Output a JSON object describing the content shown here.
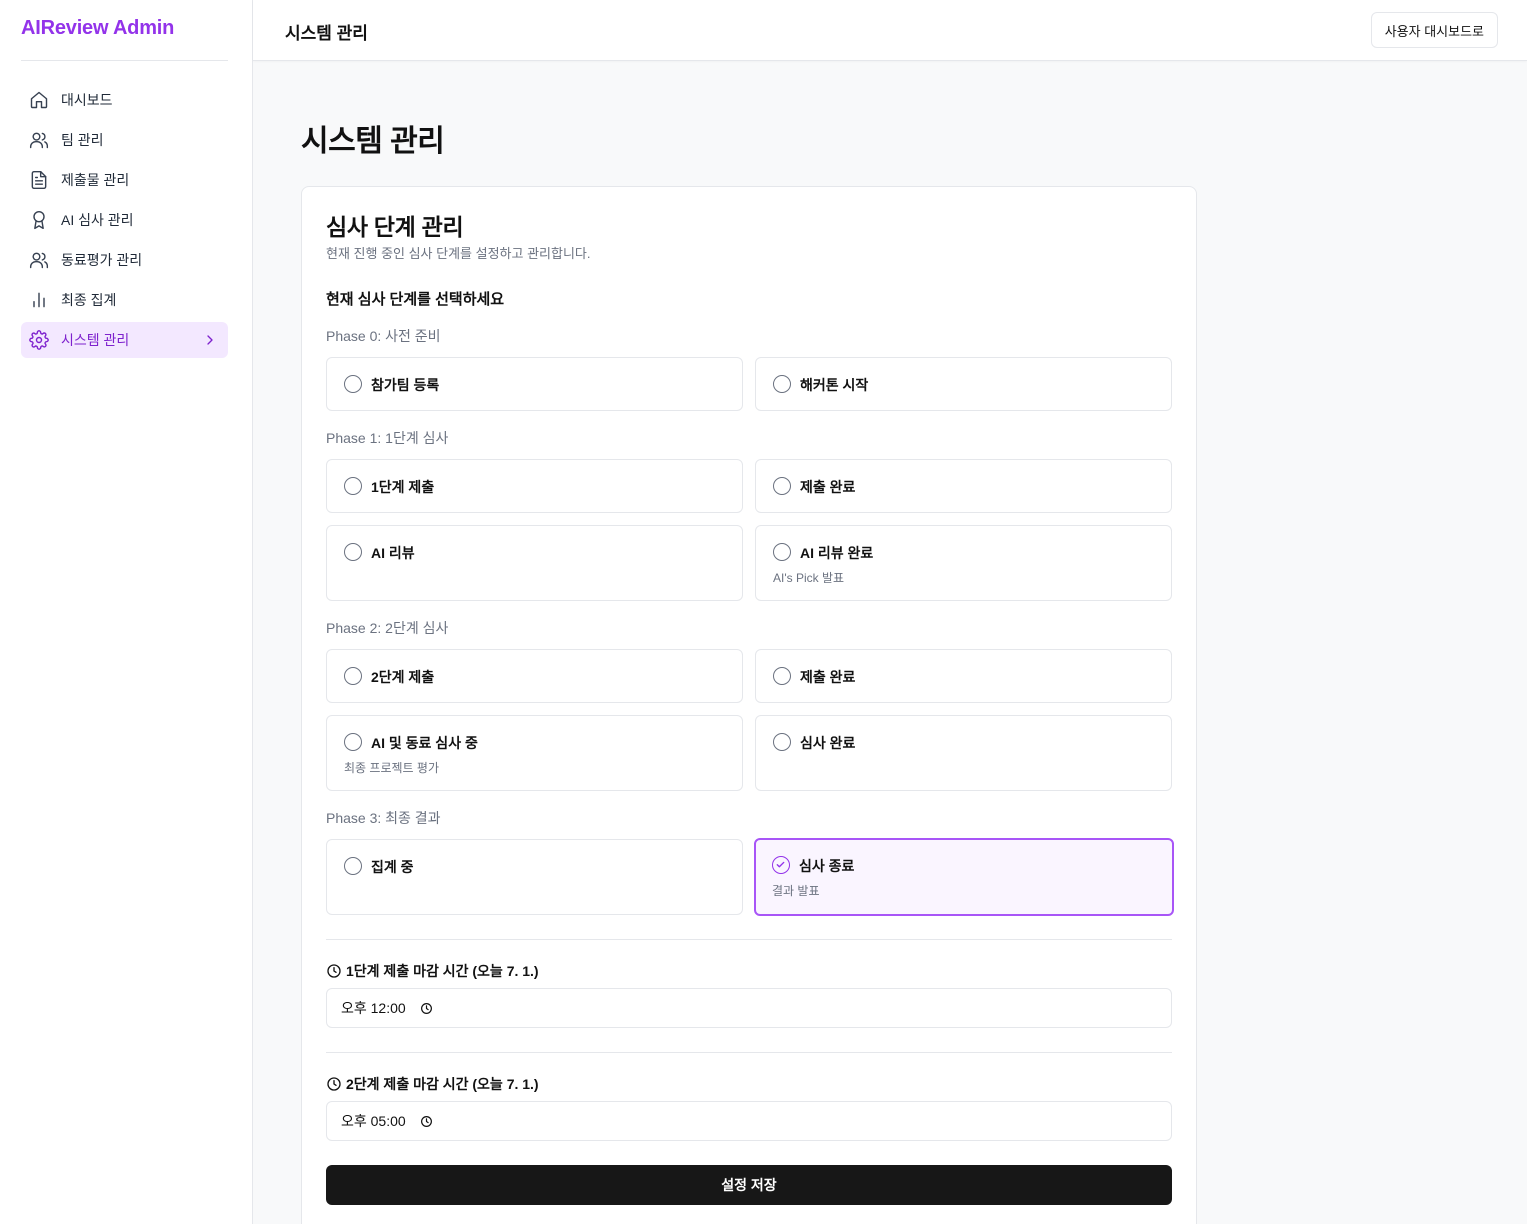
{
  "brand": "AIReview Admin",
  "nav": [
    {
      "label": "대시보드",
      "icon": "home-icon"
    },
    {
      "label": "팀 관리",
      "icon": "users-icon"
    },
    {
      "label": "제출물 관리",
      "icon": "file-text-icon"
    },
    {
      "label": "AI 심사 관리",
      "icon": "award-icon"
    },
    {
      "label": "동료평가 관리",
      "icon": "users-icon"
    },
    {
      "label": "최종 집계",
      "icon": "bar-chart-icon"
    },
    {
      "label": "시스템 관리",
      "icon": "gear-icon",
      "active": true
    }
  ],
  "header": {
    "title": "시스템 관리",
    "user_dashboard_button": "사용자 대시보드로"
  },
  "page_title": "시스템 관리",
  "card": {
    "title": "심사 단계 관리",
    "description": "현재 진행 중인 심사 단계를 설정하고 관리합니다.",
    "select_label": "현재 심사 단계를 선택하세요"
  },
  "phases": [
    {
      "label": "Phase 0: 사전 준비",
      "options": [
        {
          "label": "참가팀 등록",
          "sub": ""
        },
        {
          "label": "해커톤 시작",
          "sub": ""
        }
      ]
    },
    {
      "label": "Phase 1: 1단계 심사",
      "options": [
        {
          "label": "1단계 제출",
          "sub": ""
        },
        {
          "label": "제출 완료",
          "sub": ""
        },
        {
          "label": "AI 리뷰",
          "sub": ""
        },
        {
          "label": "AI 리뷰 완료",
          "sub": "AI's Pick 발표"
        }
      ]
    },
    {
      "label": "Phase 2: 2단계 심사",
      "options": [
        {
          "label": "2단계 제출",
          "sub": ""
        },
        {
          "label": "제출 완료",
          "sub": ""
        },
        {
          "label": "AI 및 동료 심사 중",
          "sub": "최종 프로젝트 평가"
        },
        {
          "label": "심사 완료",
          "sub": ""
        }
      ]
    },
    {
      "label": "Phase 3: 최종 결과",
      "options": [
        {
          "label": "집계 중",
          "sub": ""
        },
        {
          "label": "심사 종료",
          "sub": "결과 발표",
          "selected": true
        }
      ]
    }
  ],
  "deadlines": {
    "phase1_label": "1단계 제출 마감 시간 (오늘 7. 1.)",
    "phase1_value": "오후 12:00",
    "phase2_label": "2단계 제출 마감 시간 (오늘 7. 1.)",
    "phase2_value": "오후 05:00"
  },
  "save_button": "설정 저장",
  "colors": {
    "brand": "#9333ea",
    "active_bg": "#f3e8ff",
    "selected_border": "#a855f7",
    "save_bg": "#171717"
  }
}
